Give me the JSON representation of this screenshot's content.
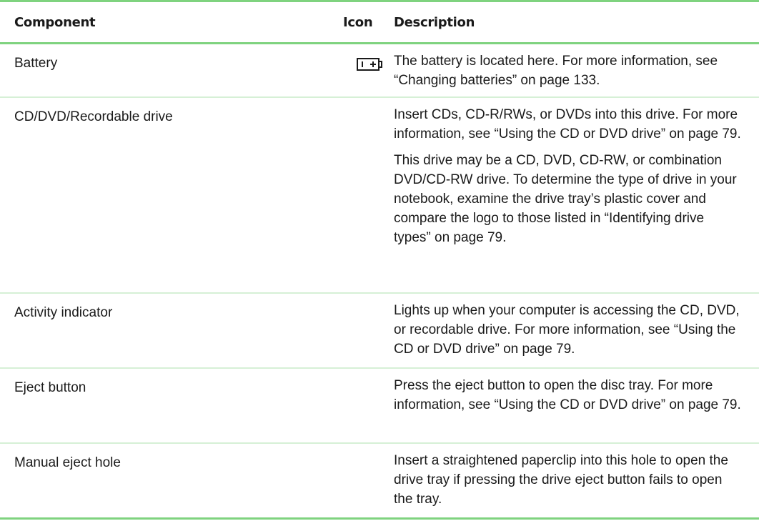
{
  "table": {
    "headers": {
      "component": "Component",
      "icon": "Icon",
      "description": "Description"
    },
    "rows": [
      {
        "component": "Battery",
        "icon": "battery-icon",
        "description": [
          "The battery is located here. For more information, see “Changing batteries” on page 133."
        ]
      },
      {
        "component": "CD/DVD/Recordable drive",
        "icon": "",
        "description": [
          "Insert CDs, CD-R/RWs, or DVDs into this drive. For more information, see “Using the CD or DVD drive” on page 79.",
          "This drive may be a CD, DVD, CD-RW, or combination DVD/CD-RW drive. To determine the type of drive in your notebook, examine the drive tray’s plastic cover and compare the logo to those listed in “Identifying drive types” on page 79."
        ]
      },
      {
        "component": "Activity indicator",
        "icon": "",
        "description": [
          "Lights up when your computer is accessing the CD, DVD, or recordable drive. For more information, see “Using the CD or DVD drive” on page 79."
        ]
      },
      {
        "component": "Eject button",
        "icon": "",
        "description": [
          "Press the eject button to open the disc tray. For more information, see “Using the CD or DVD drive” on page 79."
        ]
      },
      {
        "component": "Manual eject hole",
        "icon": "",
        "description": [
          "Insert a straightened paperclip into this hole to open the drive tray if pressing the drive eject button fails to open the tray."
        ]
      }
    ],
    "colors": {
      "rule": "#7fd37f",
      "row_divider": "#d6f0d6"
    }
  }
}
